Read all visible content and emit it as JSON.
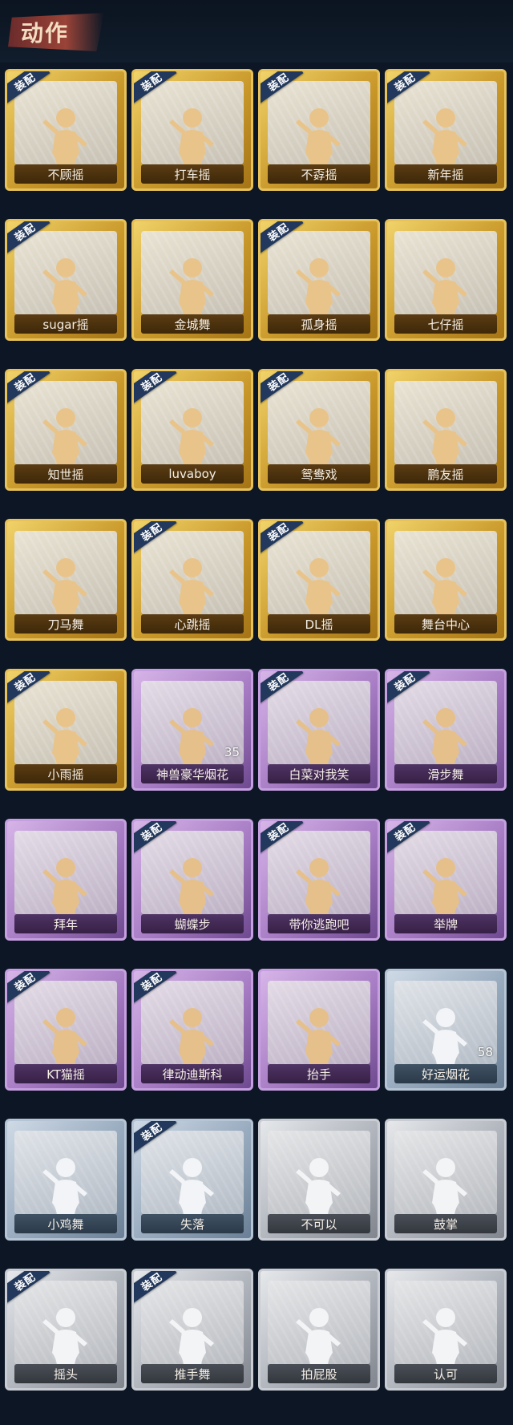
{
  "header": {
    "title": "动作"
  },
  "equip_tag": "装配",
  "colors": {
    "gold": "#c9982a",
    "purple": "#a77cc4",
    "blue": "#96a9bd",
    "silver": "#aeb3bb",
    "background": "#0d1624"
  },
  "items": [
    {
      "label": "不顾摇",
      "rarity": "gold",
      "equipped": true,
      "count": null
    },
    {
      "label": "打车摇",
      "rarity": "gold",
      "equipped": true,
      "count": null
    },
    {
      "label": "不孬摇",
      "rarity": "gold",
      "equipped": true,
      "count": null
    },
    {
      "label": "新年摇",
      "rarity": "gold",
      "equipped": true,
      "count": null
    },
    {
      "label": "sugar摇",
      "rarity": "gold",
      "equipped": true,
      "count": null
    },
    {
      "label": "金城舞",
      "rarity": "gold",
      "equipped": false,
      "count": null
    },
    {
      "label": "孤身摇",
      "rarity": "gold",
      "equipped": true,
      "count": null
    },
    {
      "label": "七仔摇",
      "rarity": "gold",
      "equipped": false,
      "count": null
    },
    {
      "label": "知世摇",
      "rarity": "gold",
      "equipped": true,
      "count": null
    },
    {
      "label": "luvaboy",
      "rarity": "gold",
      "equipped": true,
      "count": null
    },
    {
      "label": "鸳鸯戏",
      "rarity": "gold",
      "equipped": true,
      "count": null
    },
    {
      "label": "鹏友摇",
      "rarity": "gold",
      "equipped": false,
      "count": null
    },
    {
      "label": "刀马舞",
      "rarity": "gold",
      "equipped": false,
      "count": null
    },
    {
      "label": "心跳摇",
      "rarity": "gold",
      "equipped": true,
      "count": null
    },
    {
      "label": "DL摇",
      "rarity": "gold",
      "equipped": true,
      "count": null
    },
    {
      "label": "舞台中心",
      "rarity": "gold",
      "equipped": false,
      "count": null
    },
    {
      "label": "小雨摇",
      "rarity": "gold",
      "equipped": true,
      "count": null
    },
    {
      "label": "神兽豪华烟花",
      "rarity": "purple",
      "equipped": false,
      "count": "35"
    },
    {
      "label": "白菜对我笑",
      "rarity": "purple",
      "equipped": true,
      "count": null
    },
    {
      "label": "滑步舞",
      "rarity": "purple",
      "equipped": true,
      "count": null
    },
    {
      "label": "拜年",
      "rarity": "purple",
      "equipped": false,
      "count": null
    },
    {
      "label": "蝴蝶步",
      "rarity": "purple",
      "equipped": true,
      "count": null
    },
    {
      "label": "带你逃跑吧",
      "rarity": "purple",
      "equipped": true,
      "count": null
    },
    {
      "label": "举牌",
      "rarity": "purple",
      "equipped": true,
      "count": null
    },
    {
      "label": "KT猫摇",
      "rarity": "purple",
      "equipped": true,
      "count": null
    },
    {
      "label": "律动迪斯科",
      "rarity": "purple",
      "equipped": true,
      "count": null
    },
    {
      "label": "抬手",
      "rarity": "purple",
      "equipped": false,
      "count": null
    },
    {
      "label": "好运烟花",
      "rarity": "blue",
      "equipped": false,
      "count": "58"
    },
    {
      "label": "小鸡舞",
      "rarity": "blue",
      "equipped": false,
      "count": null
    },
    {
      "label": "失落",
      "rarity": "blue",
      "equipped": true,
      "count": null
    },
    {
      "label": "不可以",
      "rarity": "silver",
      "equipped": false,
      "count": null
    },
    {
      "label": "鼓掌",
      "rarity": "silver",
      "equipped": false,
      "count": null
    },
    {
      "label": "摇头",
      "rarity": "silver",
      "equipped": true,
      "count": null
    },
    {
      "label": "推手舞",
      "rarity": "silver",
      "equipped": true,
      "count": null
    },
    {
      "label": "拍屁股",
      "rarity": "silver",
      "equipped": false,
      "count": null
    },
    {
      "label": "认可",
      "rarity": "silver",
      "equipped": false,
      "count": null
    }
  ]
}
